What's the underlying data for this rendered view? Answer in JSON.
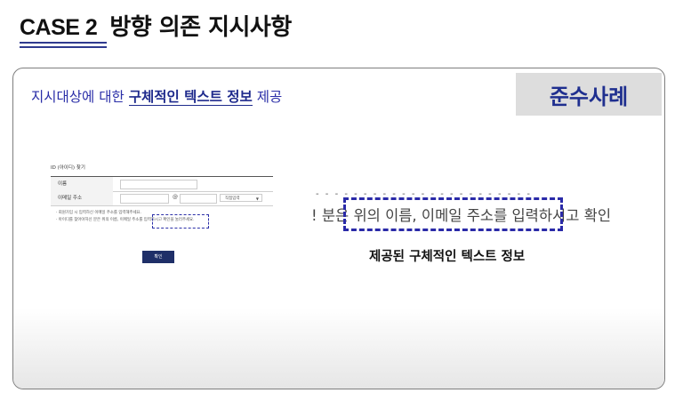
{
  "heading": {
    "case_label": "CASE 2",
    "title": "방향 의존 지시사항"
  },
  "panel": {
    "subtitle_prefix": "지시대상에 대한 ",
    "subtitle_emphasis": "구체적인 텍스트 정보",
    "subtitle_suffix": " 제공",
    "badge": "준수사례"
  },
  "mini_form": {
    "title": "ID (아이디) 찾기",
    "name_label": "이름",
    "email_label": "이메일 주소",
    "at_symbol": "@",
    "domain_select_value": "직접입력",
    "note1": "·  회원가입 시 입력하신 이메일 주소를 입력해주세요.",
    "note2": "·  아이디를 찾아야하신 분은 위의 이름, 이메일 주소를 입력하시고 확인을 눌러주세요.",
    "confirm_button": "확인"
  },
  "zoom": {
    "text": "! 분은 위의 이름, 이메일 주소를 입력하시고 확인",
    "caption": "제공된 구체적인 텍스트 정보"
  },
  "colors": {
    "accent": "#2b2fa8",
    "badge_bg": "#dddddd",
    "button": "#1f2f68"
  }
}
